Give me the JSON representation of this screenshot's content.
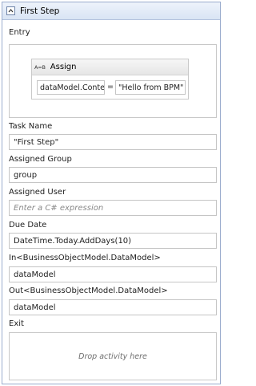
{
  "activity": {
    "title": "First Step"
  },
  "entry": {
    "label": "Entry",
    "assign": {
      "icon_text": "A=B",
      "title": "Assign",
      "to": "dataModel.Content",
      "equals": "=",
      "value": "\"Hello from BPM\""
    }
  },
  "fields": {
    "task_name": {
      "label": "Task Name",
      "value": "\"First Step\""
    },
    "assigned_group": {
      "label": "Assigned Group",
      "value": "group"
    },
    "assigned_user": {
      "label": "Assigned User",
      "placeholder": "Enter a C# expression"
    },
    "due_date": {
      "label": "Due Date",
      "value": "DateTime.Today.AddDays(10)"
    },
    "in_arg": {
      "label": "In<BusinessObjectModel.DataModel>",
      "value": "dataModel"
    },
    "out_arg": {
      "label": "Out<BusinessObjectModel.DataModel>",
      "value": "dataModel"
    }
  },
  "exit": {
    "label": "Exit",
    "drop_text": "Drop activity here"
  }
}
